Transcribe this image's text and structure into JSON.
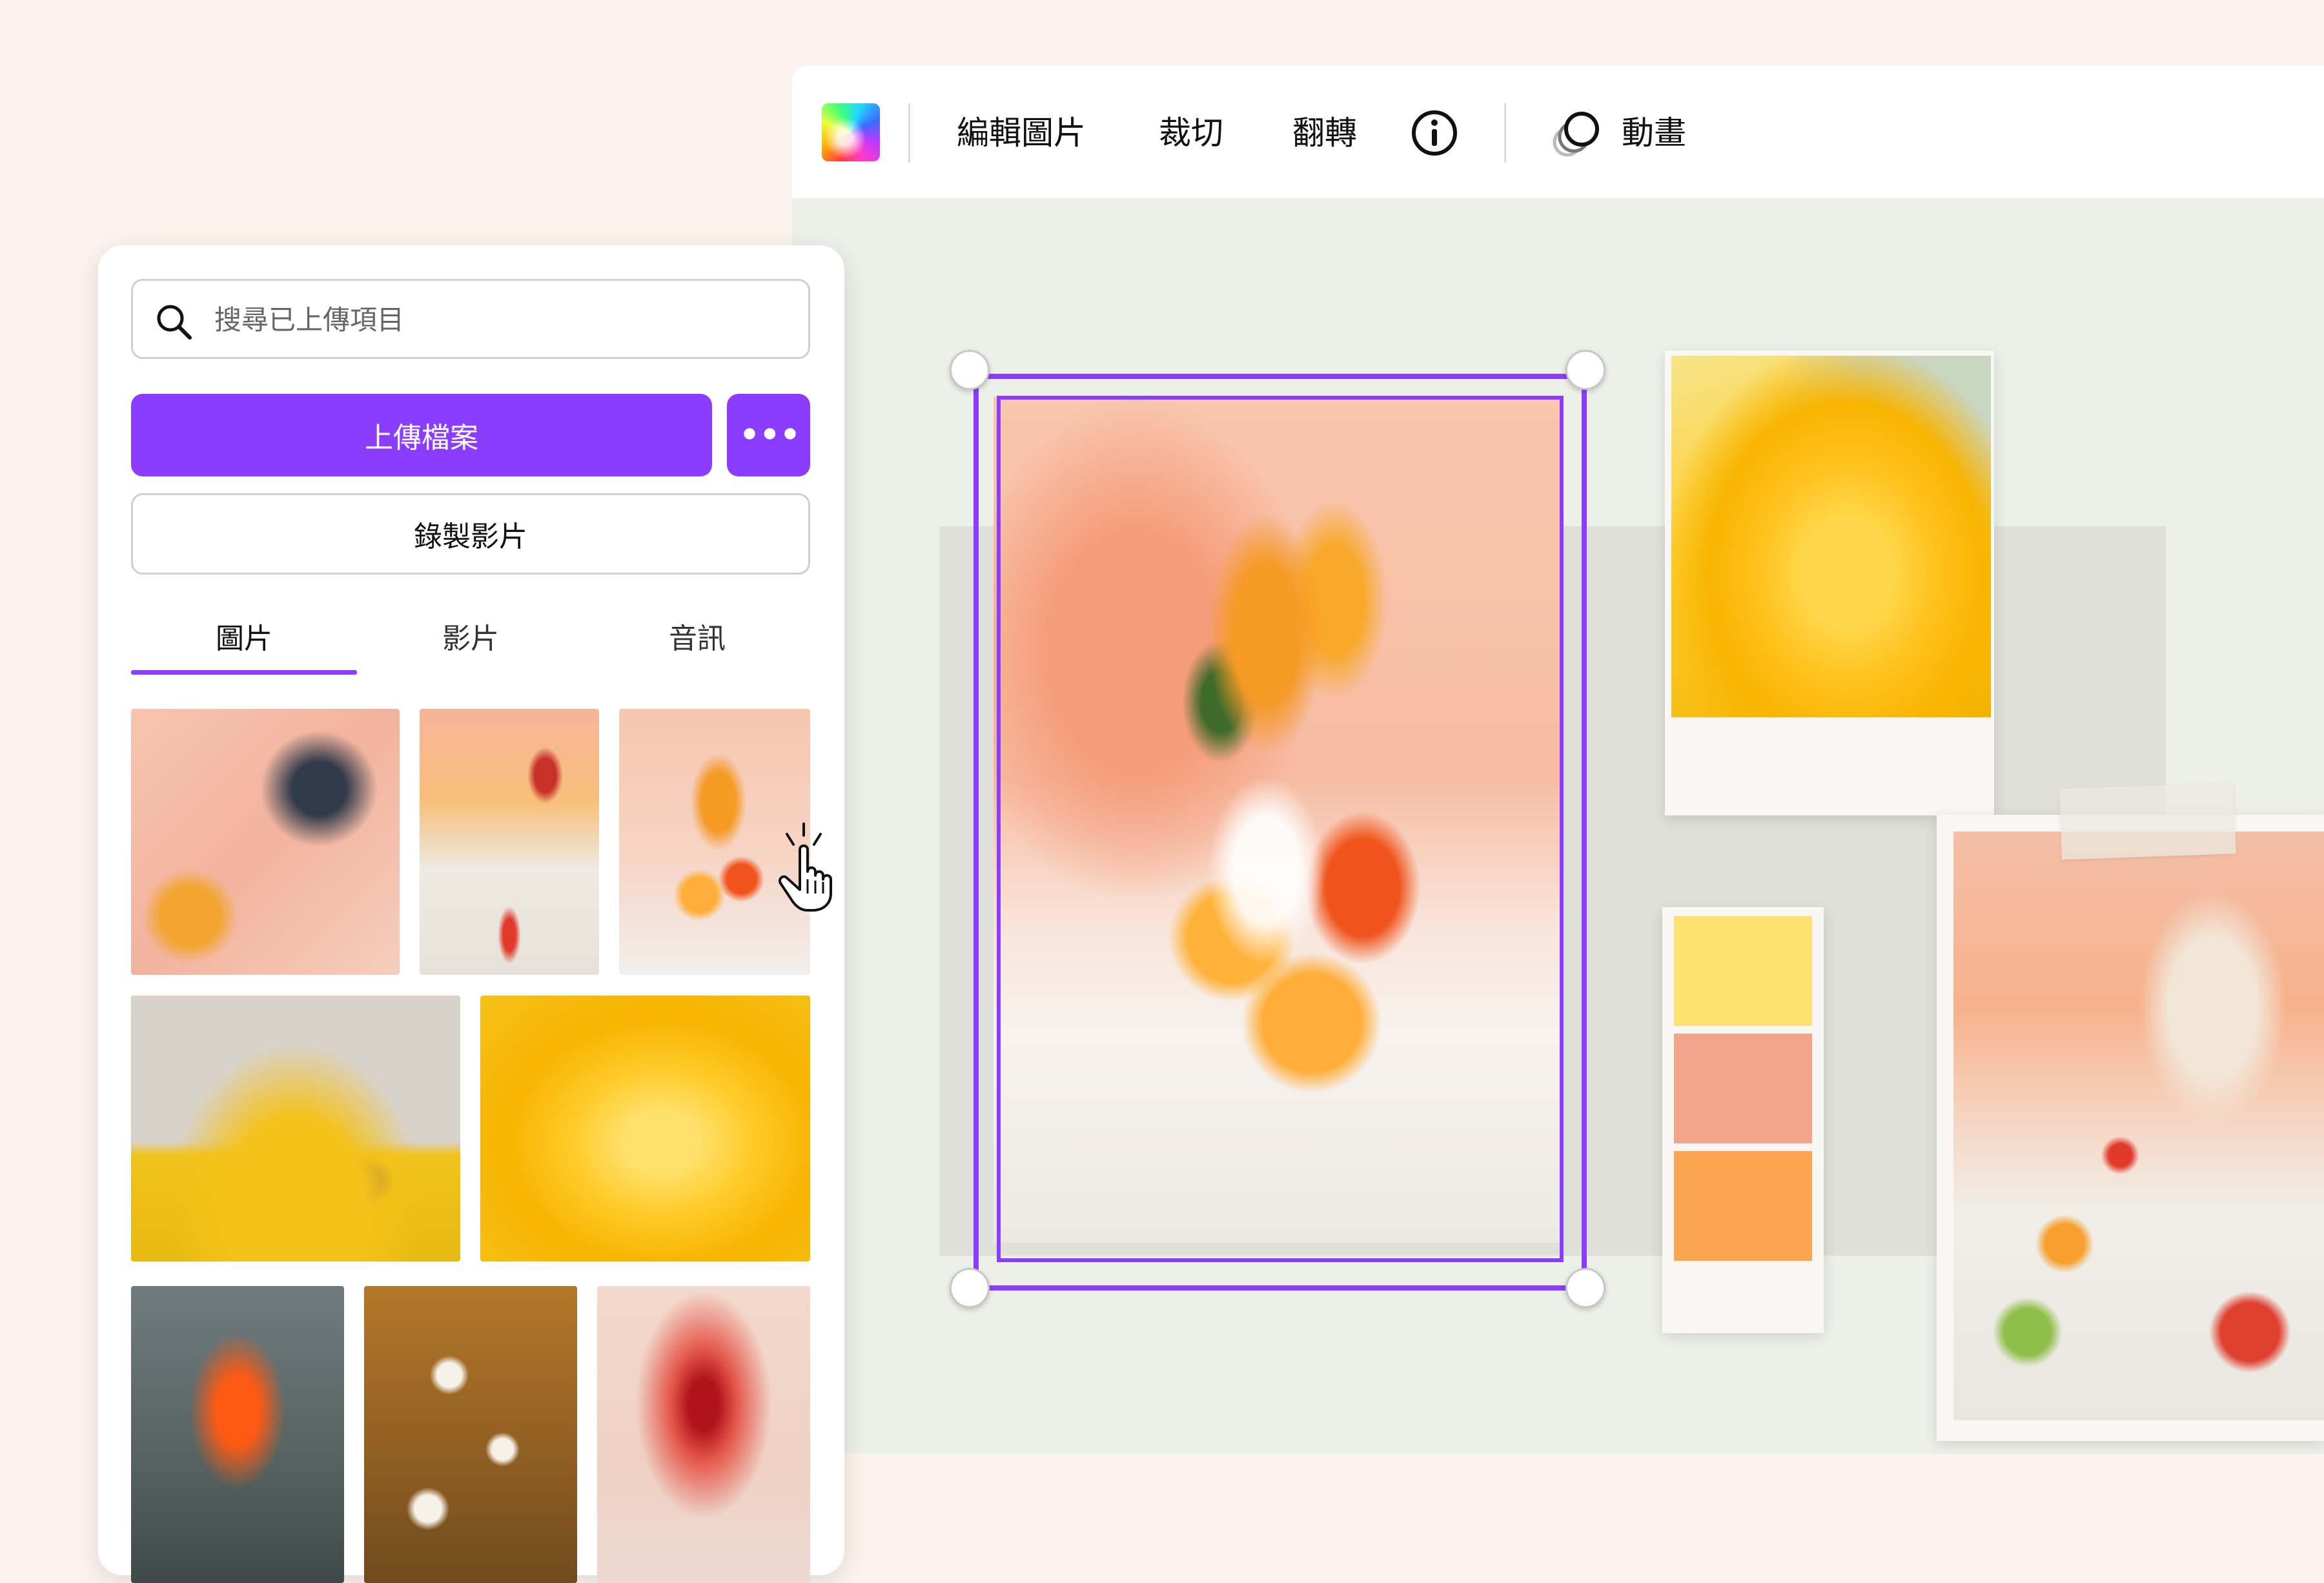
{
  "toolbar": {
    "edit_image_label": "編輯圖片",
    "crop_label": "裁切",
    "flip_label": "翻轉",
    "animate_label": "動畫"
  },
  "sidebar": {
    "search_placeholder": "搜尋已上傳項目",
    "upload_label": "上傳檔案",
    "more_label": "•••",
    "record_label": "錄製影片",
    "tabs": [
      {
        "label": "圖片",
        "active": true
      },
      {
        "label": "影片",
        "active": false
      },
      {
        "label": "音訊",
        "active": false
      }
    ]
  },
  "palette": {
    "colors": [
      "#fde272",
      "#f3a58c",
      "#fba550"
    ]
  },
  "colors": {
    "accent": "#8b3dff",
    "background": "#fdf3ee"
  }
}
